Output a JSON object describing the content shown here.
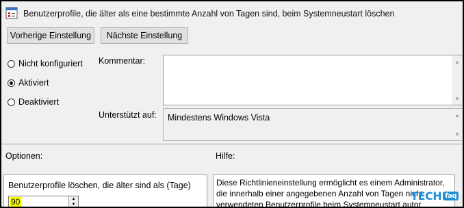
{
  "window": {
    "title": "Benutzerprofile, die älter als eine bestimmte Anzahl von Tagen sind, beim Systemneustart löschen"
  },
  "nav": {
    "previous_label": "Vorherige Einstellung",
    "next_label": "Nächste Einstellung"
  },
  "state": {
    "options": [
      {
        "label": "Nicht konfiguriert",
        "selected": false
      },
      {
        "label": "Aktiviert",
        "selected": true
      },
      {
        "label": "Deaktiviert",
        "selected": false
      }
    ]
  },
  "comment": {
    "label": "Kommentar:",
    "value": ""
  },
  "supported": {
    "label": "Unterstützt auf:",
    "value": "Mindestens Windows Vista"
  },
  "options_section": {
    "label": "Optionen:",
    "field_label": "Benutzerprofile löschen, die älter sind als (Tage)",
    "field_value": "90"
  },
  "help_section": {
    "label": "Hilfe:",
    "lines": [
      "Diese Richtlinieneinstellung ermöglicht es einem Administrator,",
      "die innerhalb einer angegebenen Anzahl von Tagen nicht",
      "verwendeten Benutzerprofile beim Systemneustart autor"
    ]
  },
  "watermark": {
    "brand": "TECH",
    "suffix": "faq"
  },
  "colors": {
    "accent": "#1e8ed6",
    "highlight": "#ffff00"
  }
}
